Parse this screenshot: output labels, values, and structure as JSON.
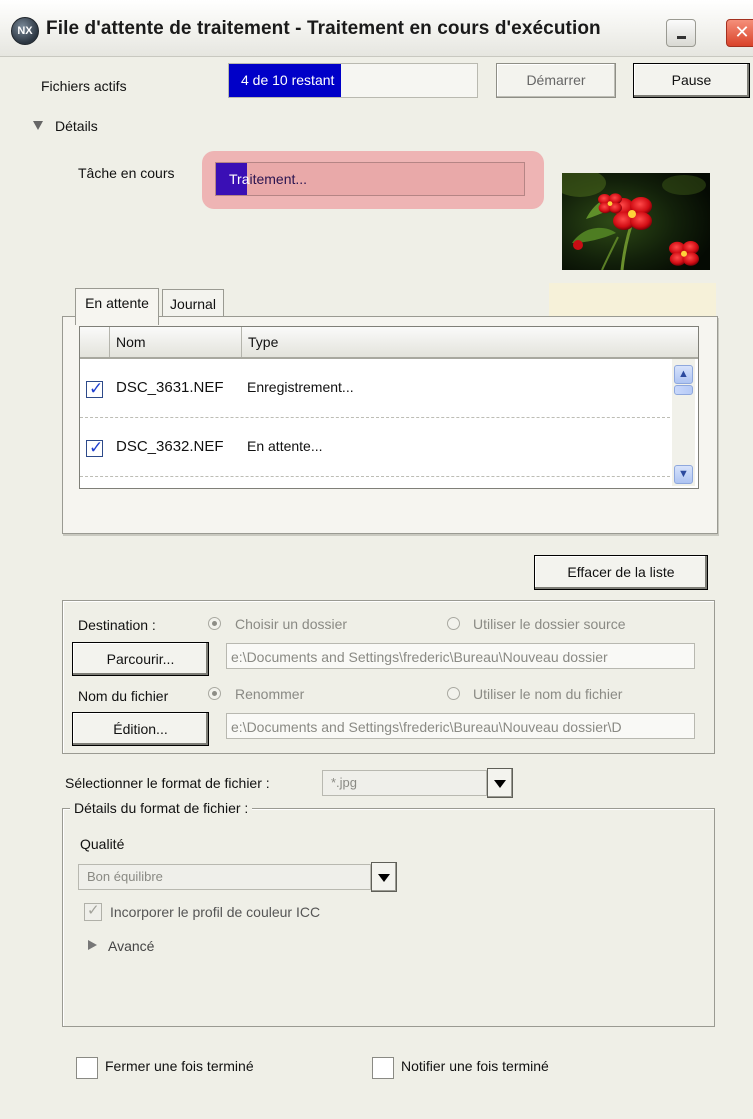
{
  "window": {
    "title": "File d'attente de traitement - Traitement en cours d'exécution",
    "app_icon_text": "NX",
    "close_glyph": "✕"
  },
  "top": {
    "active_files_label": "Fichiers actifs",
    "progress_text": "4 de 10 restant",
    "progress_fraction": 0.45,
    "start_button": "Démarrer",
    "pause_button": "Pause"
  },
  "details": {
    "label": "Détails",
    "current_task_label": "Tâche en cours",
    "task_text_prefix": "Tra",
    "task_text_rest": "itement...",
    "task_progress_fraction": 0.1
  },
  "tabs": {
    "queue": "En attente",
    "log": "Journal"
  },
  "list": {
    "columns": [
      "",
      "Nom",
      "Type"
    ],
    "rows": [
      {
        "checked": true,
        "check_glyph": "✓",
        "name": "DSC_3631.NEF",
        "type": "Enregistrement..."
      },
      {
        "checked": true,
        "check_glyph": "✓",
        "name": "DSC_3632.NEF",
        "type": "En attente..."
      }
    ],
    "scroll_up_glyph": "▲",
    "scroll_down_glyph": "▼"
  },
  "clear_list_button": "Effacer de la liste",
  "destination": {
    "label": "Destination :",
    "choose_folder": "Choisir un dossier",
    "use_source_folder": "Utiliser le dossier source",
    "browse_button": "Parcourir...",
    "path": "e:\\Documents and Settings\\frederic\\Bureau\\Nouveau dossier"
  },
  "file_name": {
    "label": "Nom du fichier",
    "rename": "Renommer",
    "use_file_name": "Utiliser le nom du fichier",
    "edit_button": "Édition...",
    "path": "e:\\Documents and Settings\\frederic\\Bureau\\Nouveau dossier\\D"
  },
  "format": {
    "select_label": "Sélectionner le format de fichier :",
    "selected_format": "*.jpg",
    "details_label": "Détails du format de fichier :",
    "quality_label": "Qualité",
    "quality_value": "Bon équilibre",
    "embed_icc_label": "Incorporer le profil de couleur ICC",
    "embed_icc_glyph": "✓",
    "advanced_label": "Avancé"
  },
  "footer": {
    "close_when_done": "Fermer une fois terminé",
    "notify_when_done": "Notifier une fois terminé"
  },
  "icons": {
    "app": "nx-app-icon",
    "minimize": "minimize-icon",
    "close": "close-icon",
    "details_toggle": "triangle-down-icon",
    "advanced_toggle": "triangle-right-icon"
  },
  "colors": {
    "progress": "#0000c8",
    "task_progress": "#3a0fb5",
    "task_highlight": "#eeb4b4",
    "checkbox_check": "#1f3fd0"
  }
}
